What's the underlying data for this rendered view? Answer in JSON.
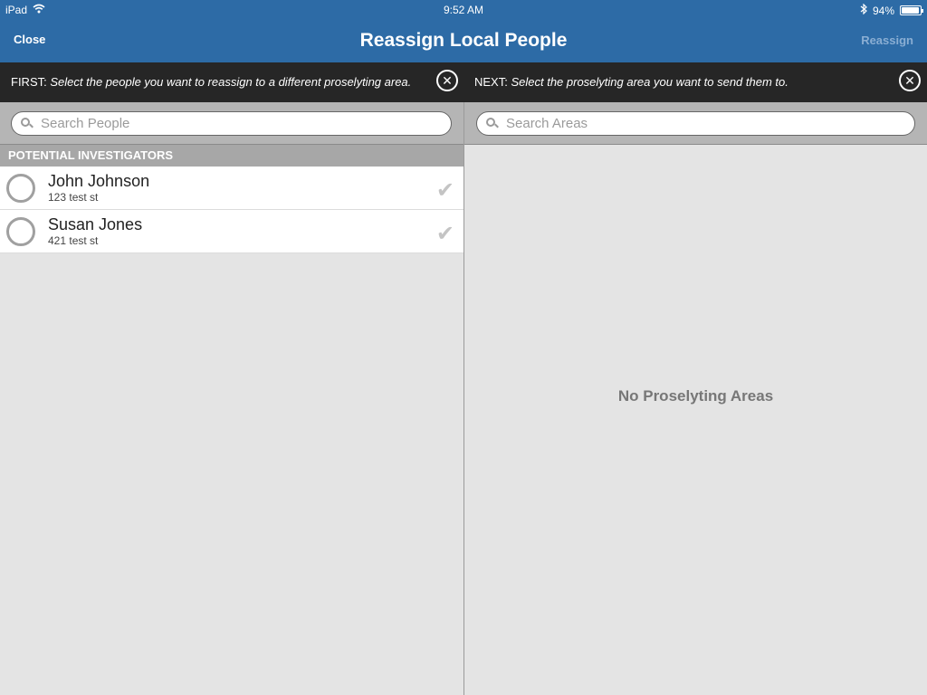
{
  "status": {
    "device": "iPad",
    "time": "9:52 AM",
    "battery": "94%",
    "battery_level": 0.94
  },
  "nav": {
    "close": "Close",
    "title": "Reassign Local People",
    "reassign": "Reassign"
  },
  "instructions": {
    "first_prefix": "FIRST:",
    "first_text": "Select the people you want to reassign to a different proselyting area.",
    "next_prefix": "NEXT:",
    "next_text": "Select the proselyting area you want to send them to."
  },
  "left": {
    "search_placeholder": "Search People",
    "section": "POTENTIAL INVESTIGATORS",
    "people": [
      {
        "name": "John Johnson",
        "address": "123 test st"
      },
      {
        "name": "Susan Jones",
        "address": "421 test st"
      }
    ]
  },
  "right": {
    "search_placeholder": "Search Areas",
    "empty": "No Proselyting Areas"
  },
  "colors": {
    "accent": "#2d6ba6",
    "instruction_bg": "#262626"
  }
}
